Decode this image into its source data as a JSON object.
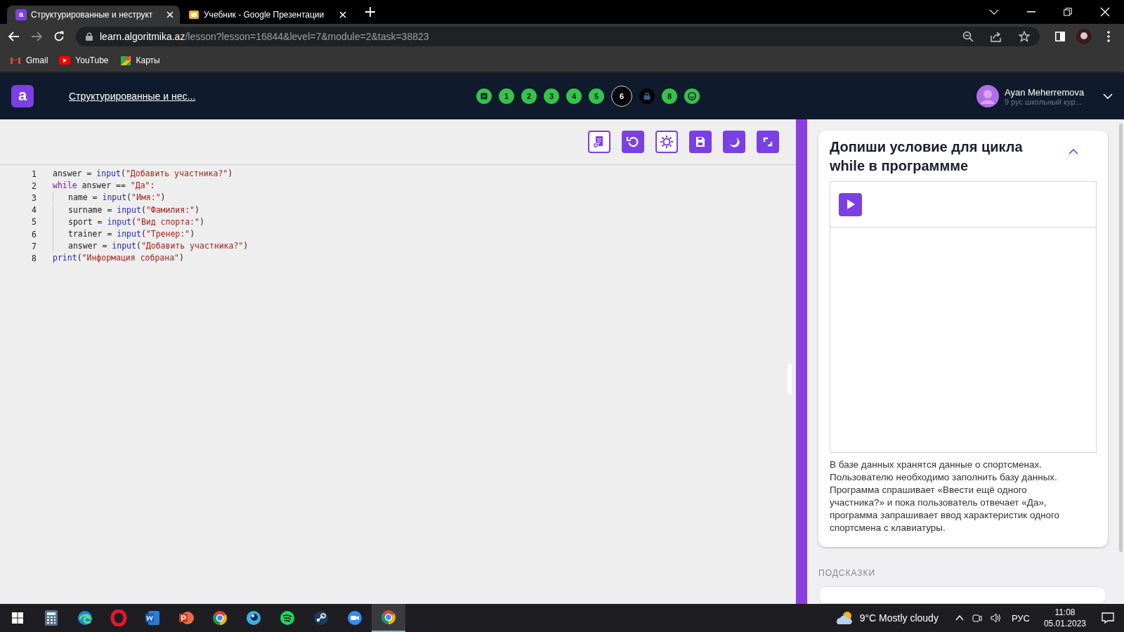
{
  "browser": {
    "tabs": [
      {
        "title": "Структурированные и неструкт",
        "selected": true,
        "icon": "a"
      },
      {
        "title": "Учебник - Google Презентации",
        "selected": false
      }
    ],
    "address": {
      "host": "learn.algoritmika.az",
      "path": "/lesson?lesson=16844&level=7&module=2&task=38823"
    },
    "bookmarks": [
      {
        "label": "Gmail"
      },
      {
        "label": "YouTube"
      },
      {
        "label": "Карты"
      }
    ]
  },
  "header": {
    "logo": "a",
    "lesson_title": "Структурированные и нес...",
    "steps": [
      {
        "kind": "notes",
        "completed": true,
        "selected": false
      },
      {
        "kind": "number",
        "label": "1",
        "completed": true,
        "selected": false
      },
      {
        "kind": "number",
        "label": "2",
        "completed": true,
        "selected": false
      },
      {
        "kind": "number",
        "label": "3",
        "completed": true,
        "selected": false
      },
      {
        "kind": "number",
        "label": "4",
        "completed": true,
        "selected": false
      },
      {
        "kind": "number",
        "label": "5",
        "completed": true,
        "selected": false
      },
      {
        "kind": "number",
        "label": "6",
        "completed": false,
        "selected": true
      },
      {
        "kind": "lock",
        "completed": false,
        "selected": false
      },
      {
        "kind": "number",
        "label": "8",
        "completed": true,
        "selected": false
      },
      {
        "kind": "smile",
        "completed": true,
        "selected": false
      }
    ],
    "user": {
      "name": "Ayan Meherremova",
      "course": "9 рус школьный кур..."
    }
  },
  "editor": {
    "toolbar": [
      {
        "kind": "add-file",
        "outlined": true
      },
      {
        "kind": "undo",
        "outlined": false
      },
      {
        "kind": "bug",
        "outlined": true
      },
      {
        "kind": "save",
        "outlined": false
      },
      {
        "kind": "moon",
        "outlined": false
      },
      {
        "kind": "expand",
        "outlined": false
      }
    ],
    "lines": [
      {
        "number": "1",
        "indent": false,
        "tokens": [
          {
            "kind": "plain",
            "text": "answer = "
          },
          {
            "kind": "builtin",
            "text": "input"
          },
          {
            "kind": "plain",
            "text": "("
          },
          {
            "kind": "string",
            "text": "\"Добавить участника?\""
          },
          {
            "kind": "plain",
            "text": ")"
          }
        ]
      },
      {
        "number": "2",
        "indent": false,
        "tokens": [
          {
            "kind": "keyword",
            "text": "while"
          },
          {
            "kind": "plain",
            "text": " answer == "
          },
          {
            "kind": "string",
            "text": "\"Да\""
          },
          {
            "kind": "plain",
            "text": ":"
          }
        ]
      },
      {
        "number": "3",
        "indent": true,
        "tokens": [
          {
            "kind": "plain",
            "text": "name = "
          },
          {
            "kind": "builtin",
            "text": "input"
          },
          {
            "kind": "plain",
            "text": "("
          },
          {
            "kind": "string",
            "text": "\"Имя:\""
          },
          {
            "kind": "plain",
            "text": ")"
          }
        ]
      },
      {
        "number": "4",
        "indent": true,
        "tokens": [
          {
            "kind": "plain",
            "text": "surname = "
          },
          {
            "kind": "builtin",
            "text": "input"
          },
          {
            "kind": "plain",
            "text": "("
          },
          {
            "kind": "string",
            "text": "\"Фамилия:\""
          },
          {
            "kind": "plain",
            "text": ")"
          }
        ]
      },
      {
        "number": "5",
        "indent": true,
        "tokens": [
          {
            "kind": "plain",
            "text": "sport = "
          },
          {
            "kind": "builtin",
            "text": "input"
          },
          {
            "kind": "plain",
            "text": "("
          },
          {
            "kind": "string",
            "text": "\"Вид спорта:\""
          },
          {
            "kind": "plain",
            "text": ")"
          }
        ]
      },
      {
        "number": "6",
        "indent": true,
        "tokens": [
          {
            "kind": "plain",
            "text": "trainer = "
          },
          {
            "kind": "builtin",
            "text": "input"
          },
          {
            "kind": "plain",
            "text": "("
          },
          {
            "kind": "string",
            "text": "\"Тренер:\""
          },
          {
            "kind": "plain",
            "text": ")"
          }
        ]
      },
      {
        "number": "7",
        "indent": true,
        "tokens": [
          {
            "kind": "plain",
            "text": "answer = "
          },
          {
            "kind": "builtin",
            "text": "input"
          },
          {
            "kind": "plain",
            "text": "("
          },
          {
            "kind": "string",
            "text": "\"Добавить участника?\""
          },
          {
            "kind": "plain",
            "text": ")"
          }
        ]
      },
      {
        "number": "8",
        "indent": false,
        "tokens": [
          {
            "kind": "builtin",
            "text": "print"
          },
          {
            "kind": "plain",
            "text": "("
          },
          {
            "kind": "string",
            "text": "\"Информация собрана\""
          },
          {
            "kind": "plain",
            "text": ")"
          }
        ]
      }
    ]
  },
  "task": {
    "title": "Допиши условие для цикла while в программме",
    "expanded": true,
    "description": "В базе данных хранятся данные о спортсменах. Пользователю необходимо заполнить базу данных. Программа спрашивает «Ввести ещё одного участника?» и пока пользователь отвечает «Да», программа запрашивает ввод характеристик одного спортсмена с клавиатуры.",
    "hints_label": "ПОДСКАЗКИ"
  },
  "taskbar": {
    "apps": [
      {
        "kind": "calculator",
        "active": false
      },
      {
        "kind": "edge",
        "active": false
      },
      {
        "kind": "opera",
        "active": false
      },
      {
        "kind": "word",
        "active": false
      },
      {
        "kind": "powerpoint",
        "active": false
      },
      {
        "kind": "chrome",
        "active": false
      },
      {
        "kind": "bubble",
        "active": false
      },
      {
        "kind": "spotify",
        "active": false
      },
      {
        "kind": "steam",
        "active": false
      },
      {
        "kind": "zoom",
        "active": false
      },
      {
        "kind": "chrome",
        "active": true
      }
    ],
    "weather": "9°C  Mostly cloudy",
    "language": "РУС",
    "time": "11:08",
    "date": "05.01.2023"
  }
}
